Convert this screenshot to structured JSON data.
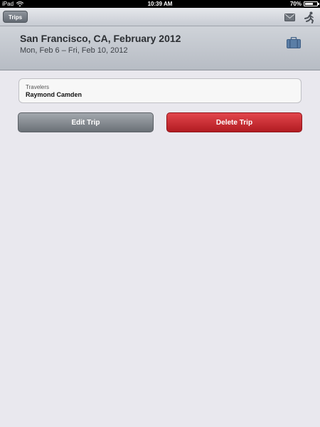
{
  "status_bar": {
    "device": "iPad",
    "time": "10:39 AM",
    "battery": "70%",
    "battery_level": 0.7
  },
  "nav": {
    "back_label": "Trips",
    "icons": [
      "mail-icon",
      "runner-icon"
    ]
  },
  "trip": {
    "title": "San Francisco, CA, February 2012",
    "dates": "Mon, Feb 6 – Fri, Feb 10, 2012",
    "icon": "suitcase-icon"
  },
  "travelers": {
    "label": "Travelers",
    "value": "Raymond Camden"
  },
  "actions": {
    "edit_label": "Edit Trip",
    "delete_label": "Delete Trip"
  },
  "colors": {
    "background": "#e9e8ee",
    "delete_red": "#c8282e",
    "edit_gray": "#80868c"
  }
}
